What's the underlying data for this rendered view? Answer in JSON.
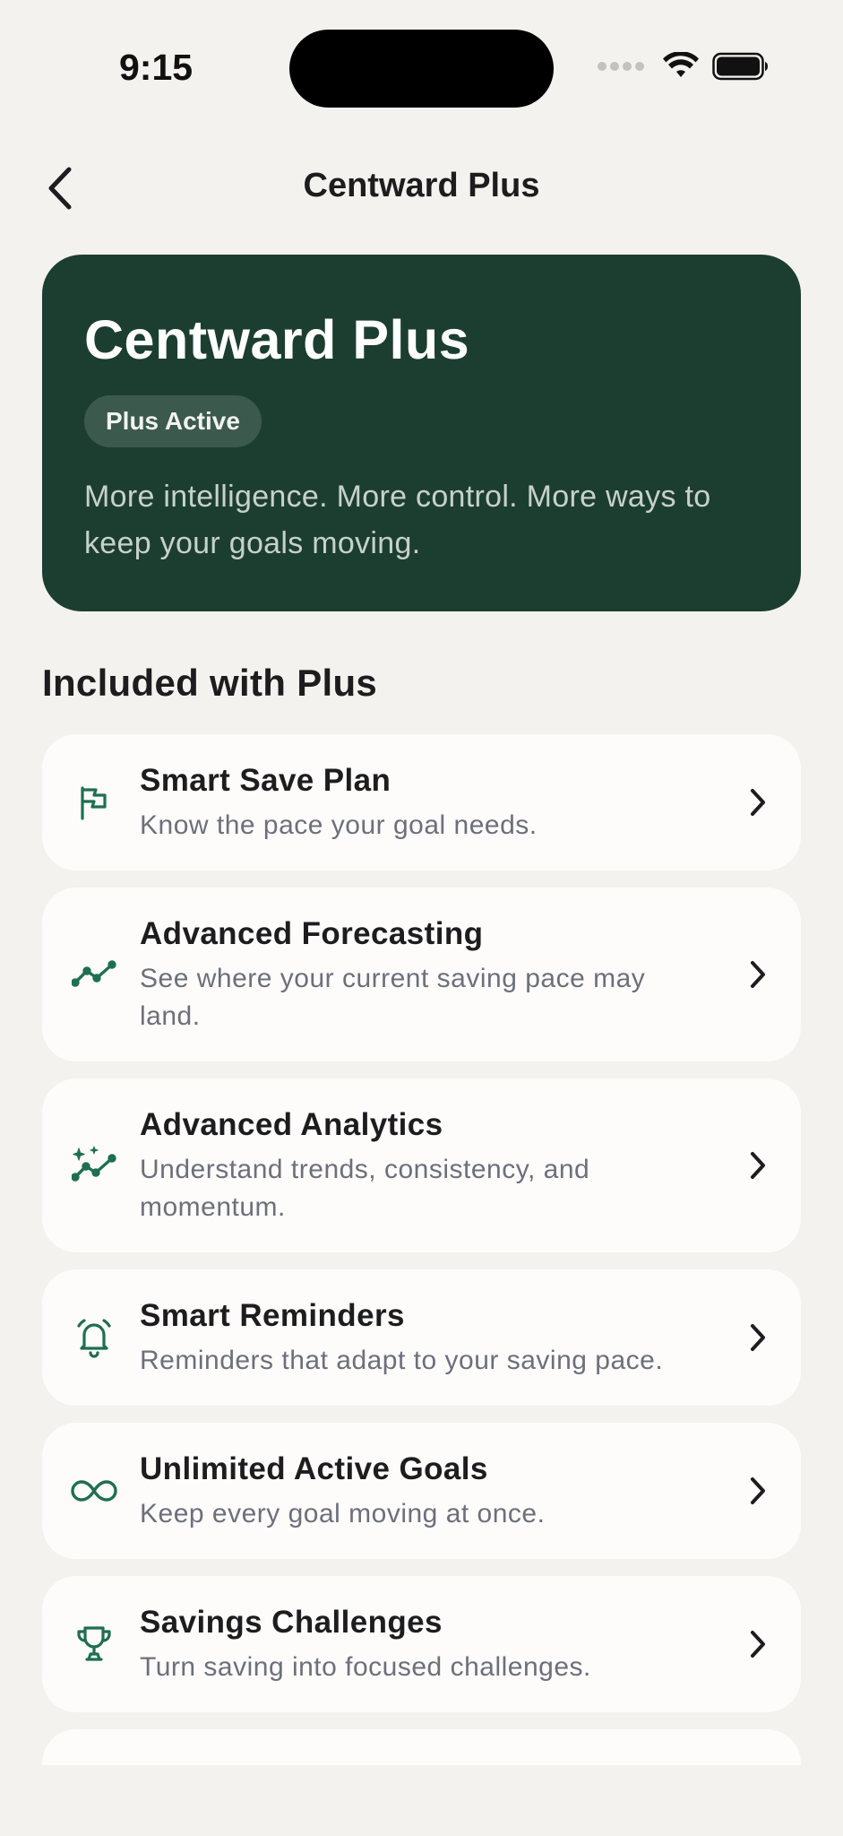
{
  "status_bar": {
    "time": "9:15"
  },
  "nav": {
    "title": "Centward Plus",
    "back_icon": "chevron-left-icon"
  },
  "hero": {
    "title": "Centward Plus",
    "badge": "Plus Active",
    "description": "More intelligence. More control. More ways to keep your goals moving.",
    "background_color": "#1c3e31"
  },
  "section": {
    "title": "Included with Plus"
  },
  "accent_color": "#1f6e52",
  "features": [
    {
      "title": "Smart Save Plan",
      "description": "Know the pace your goal needs.",
      "icon": "flag-icon"
    },
    {
      "title": "Advanced Forecasting",
      "description": "See where your current saving pace may land.",
      "icon": "trend-line-icon"
    },
    {
      "title": "Advanced Analytics",
      "description": "Understand trends, consistency, and momentum.",
      "icon": "sparkle-trend-icon"
    },
    {
      "title": "Smart Reminders",
      "description": "Reminders that adapt to your saving pace.",
      "icon": "bell-icon"
    },
    {
      "title": "Unlimited Active Goals",
      "description": "Keep every goal moving at once.",
      "icon": "infinity-icon"
    },
    {
      "title": "Savings Challenges",
      "description": "Turn saving into focused challenges.",
      "icon": "trophy-icon"
    }
  ]
}
